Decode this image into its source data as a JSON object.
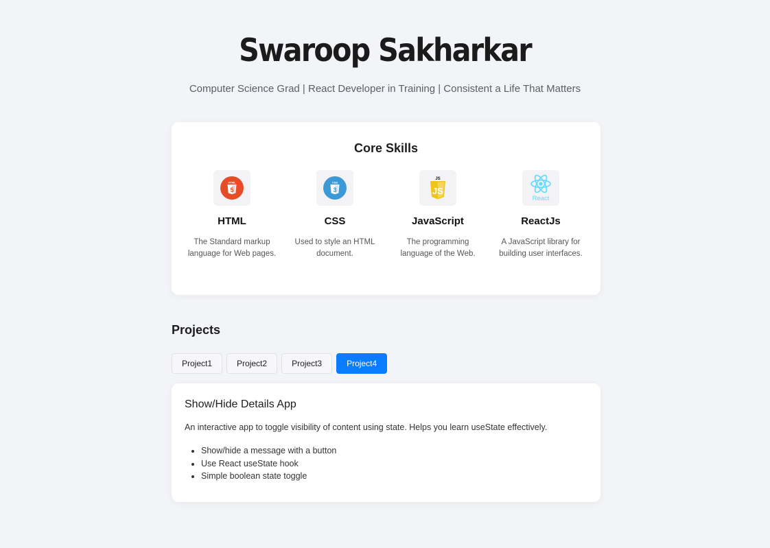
{
  "header": {
    "name": "Swaroop Sakharkar",
    "tagline": "Computer Science Grad | React Developer in Training | Consistent a Life That Matters"
  },
  "skills": {
    "title": "Core Skills",
    "items": [
      {
        "name": "HTML",
        "icon": "html5-icon",
        "description": "The Standard markup language for Web pages."
      },
      {
        "name": "CSS",
        "icon": "css3-icon",
        "description": "Used to style an HTML document."
      },
      {
        "name": "JavaScript",
        "icon": "javascript-icon",
        "description": "The programming language of the Web."
      },
      {
        "name": "ReactJs",
        "icon": "react-icon",
        "description": "A JavaScript library for building user interfaces."
      }
    ]
  },
  "projects": {
    "title": "Projects",
    "tabs": [
      "Project1",
      "Project2",
      "Project3",
      "Project4"
    ],
    "active_tab": "Project4",
    "current": {
      "title": "Show/Hide Details App",
      "description": "An interactive app to toggle visibility of content using state. Helps you learn useState effectively.",
      "features": [
        "Show/hide a message with a button",
        "Use React useState hook",
        "Simple boolean state toggle"
      ]
    }
  },
  "colors": {
    "background": "#f3f4f7",
    "accent": "#0a7cff",
    "html": "#e44d26",
    "css": "#3d99d6",
    "javascript": "#f0c419",
    "react": "#61dafb"
  },
  "icon_labels": {
    "html": "HTML",
    "css": "CSS",
    "js": "JS",
    "react": "React"
  }
}
